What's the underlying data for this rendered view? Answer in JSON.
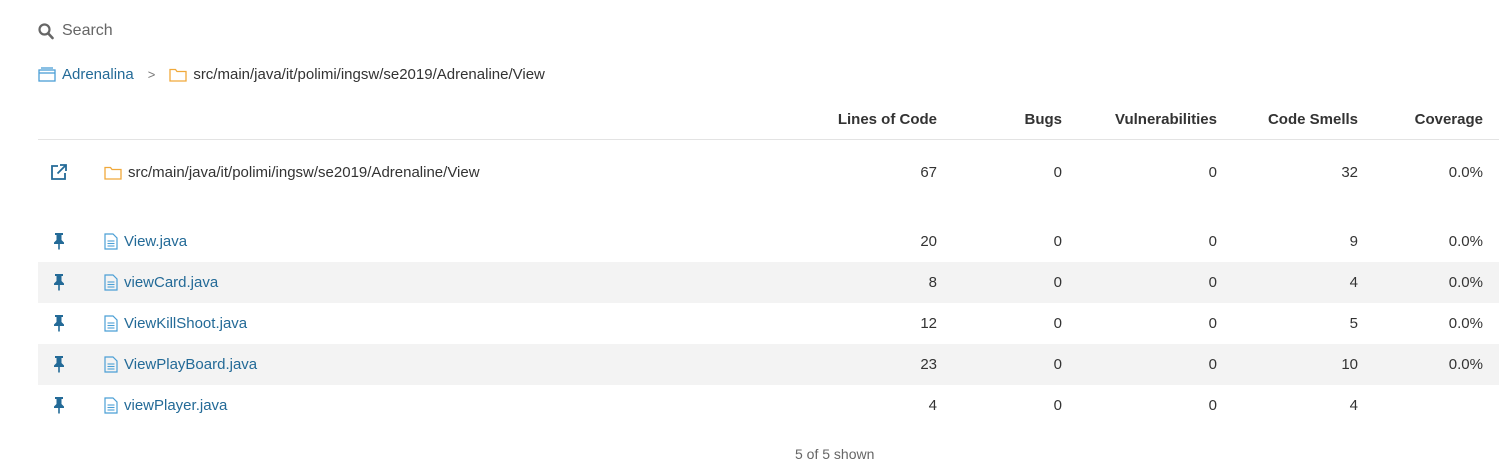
{
  "search": {
    "placeholder": "Search"
  },
  "breadcrumb": {
    "project": "Adrenalina",
    "separator": ">",
    "directory": "src/main/java/it/polimi/ingsw/se2019/Adrenaline/View"
  },
  "table": {
    "columns": [
      "Lines of Code",
      "Bugs",
      "Vulnerabilities",
      "Code Smells",
      "Coverage"
    ],
    "base_row": {
      "name": "src/main/java/it/polimi/ingsw/se2019/Adrenaline/View",
      "loc": "67",
      "bugs": "0",
      "vulnerabilities": "0",
      "code_smells": "32",
      "coverage": "0.0%"
    },
    "rows": [
      {
        "name": "View.java",
        "loc": "20",
        "bugs": "0",
        "vulnerabilities": "0",
        "code_smells": "9",
        "coverage": "0.0%"
      },
      {
        "name": "viewCard.java",
        "loc": "8",
        "bugs": "0",
        "vulnerabilities": "0",
        "code_smells": "4",
        "coverage": "0.0%"
      },
      {
        "name": "ViewKillShoot.java",
        "loc": "12",
        "bugs": "0",
        "vulnerabilities": "0",
        "code_smells": "5",
        "coverage": "0.0%"
      },
      {
        "name": "ViewPlayBoard.java",
        "loc": "23",
        "bugs": "0",
        "vulnerabilities": "0",
        "code_smells": "10",
        "coverage": "0.0%"
      },
      {
        "name": "viewPlayer.java",
        "loc": "4",
        "bugs": "0",
        "vulnerabilities": "0",
        "code_smells": "4",
        "coverage": ""
      }
    ]
  },
  "footer": {
    "count_text": "5 of 5 shown"
  },
  "colors": {
    "link": "#236a97",
    "folder": "#f0a93b",
    "alt_row": "#f3f3f3",
    "pin": "#236a97"
  },
  "icons": {
    "search": "search-icon",
    "project": "project-icon",
    "folder": "folder-icon",
    "open": "external-link-icon",
    "pin": "pin-icon",
    "file": "file-icon"
  }
}
